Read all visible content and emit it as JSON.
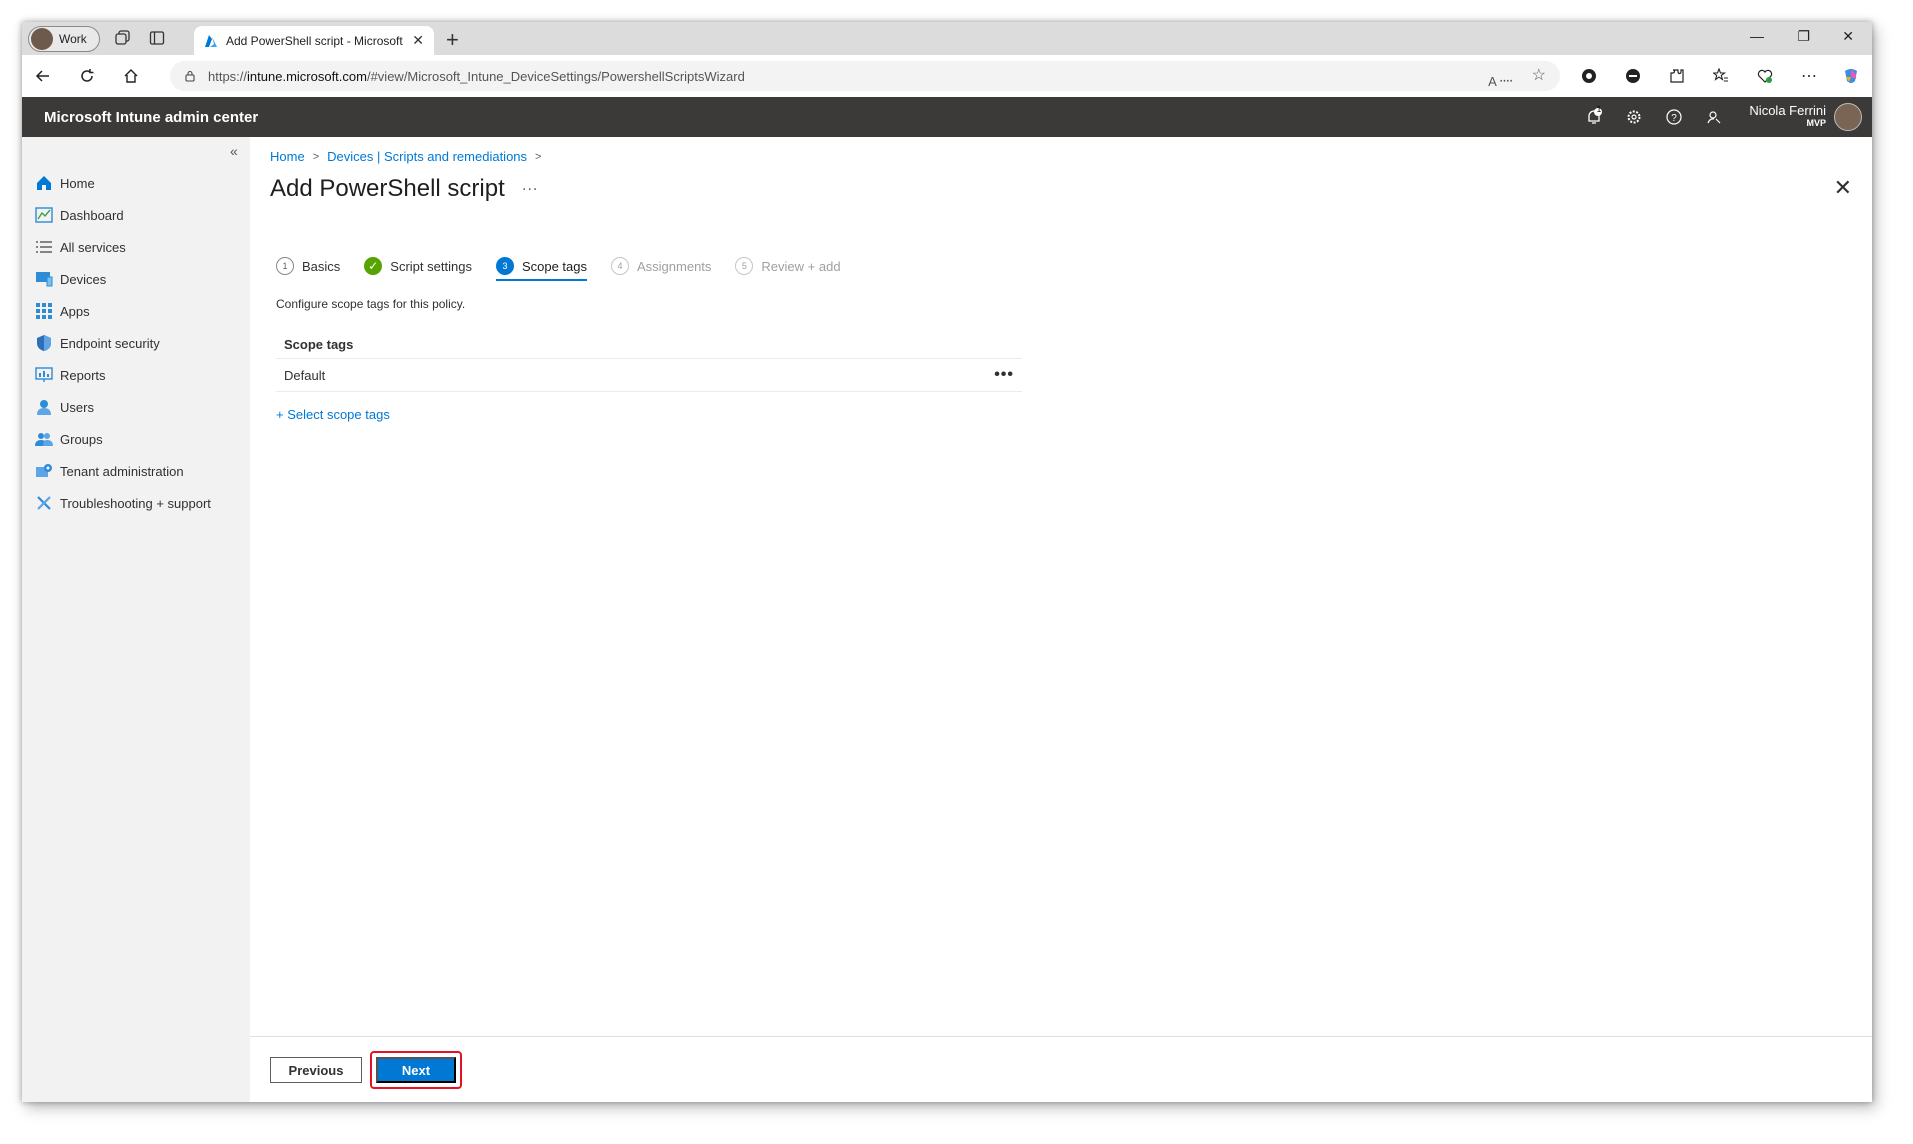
{
  "browser": {
    "profile_label": "Work",
    "tab_title": "Add PowerShell script - Microsoft",
    "url_prefix": "https://",
    "url_domain": "intune.microsoft.com",
    "url_path": "/#view/Microsoft_Intune_DeviceSettings/PowershellScriptsWizard"
  },
  "app": {
    "brand": "Microsoft Intune admin center",
    "notification_count": "1",
    "user_name": "Nicola Ferrini",
    "user_badge": "MVP"
  },
  "sidebar": {
    "items": [
      {
        "label": "Home",
        "icon": "home-icon"
      },
      {
        "label": "Dashboard",
        "icon": "dashboard-icon"
      },
      {
        "label": "All services",
        "icon": "list-icon"
      },
      {
        "label": "Devices",
        "icon": "devices-icon"
      },
      {
        "label": "Apps",
        "icon": "apps-icon"
      },
      {
        "label": "Endpoint security",
        "icon": "shield-icon"
      },
      {
        "label": "Reports",
        "icon": "reports-icon"
      },
      {
        "label": "Users",
        "icon": "user-icon"
      },
      {
        "label": "Groups",
        "icon": "groups-icon"
      },
      {
        "label": "Tenant administration",
        "icon": "tenant-icon"
      },
      {
        "label": "Troubleshooting + support",
        "icon": "tools-icon"
      }
    ]
  },
  "breadcrumb": [
    "Home",
    "Devices | Scripts and remediations"
  ],
  "page": {
    "title": "Add PowerShell script",
    "more": "...",
    "steps": [
      {
        "num": "1",
        "label": "Basics",
        "state": "normal"
      },
      {
        "num": "✓",
        "label": "Script settings",
        "state": "done"
      },
      {
        "num": "3",
        "label": "Scope tags",
        "state": "active"
      },
      {
        "num": "4",
        "label": "Assignments",
        "state": "disabled"
      },
      {
        "num": "5",
        "label": "Review + add",
        "state": "disabled"
      }
    ],
    "description": "Configure scope tags for this policy.",
    "table_header": "Scope tags",
    "row_value": "Default",
    "row_more": "•••",
    "add_link": "+ Select scope tags"
  },
  "footer": {
    "previous_label": "Previous",
    "next_label": "Next"
  },
  "colors": {
    "accent": "#0078d4",
    "header_bg": "#3b3a39",
    "done_green": "#57a300",
    "highlight": "#e81123"
  }
}
